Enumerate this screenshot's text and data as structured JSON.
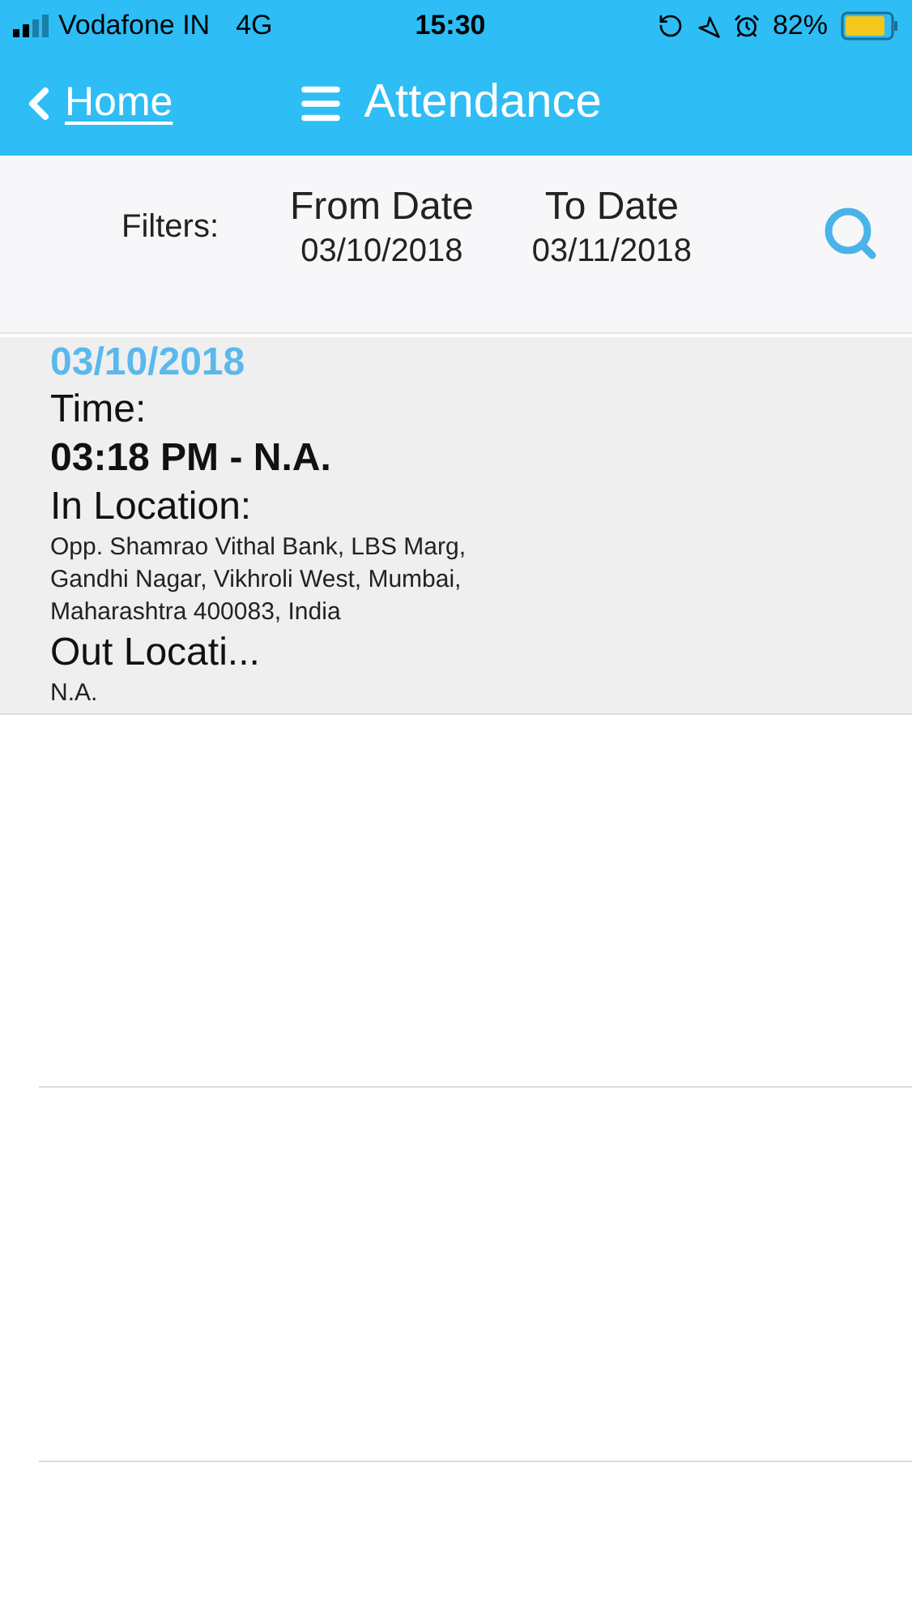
{
  "status_bar": {
    "carrier": "Vodafone IN",
    "network": "4G",
    "time": "15:30",
    "battery": "82%"
  },
  "nav": {
    "back": "Home",
    "title": "Attendance"
  },
  "filters": {
    "label": "Filters:",
    "from": {
      "label": "From Date",
      "value": "03/10/2018"
    },
    "to": {
      "label": "To Date",
      "value": "03/11/2018"
    }
  },
  "records": [
    {
      "date": "03/10/2018",
      "time_label": "Time:",
      "time": "03:18 PM - N.A.",
      "in_label": "In Location:",
      "in_location": "Opp. Shamrao Vithal Bank, LBS Marg, Gandhi Nagar, Vikhroli West, Mumbai, Maharashtra 400083, India",
      "out_label": "Out Locati...",
      "out_location": "N.A."
    }
  ]
}
